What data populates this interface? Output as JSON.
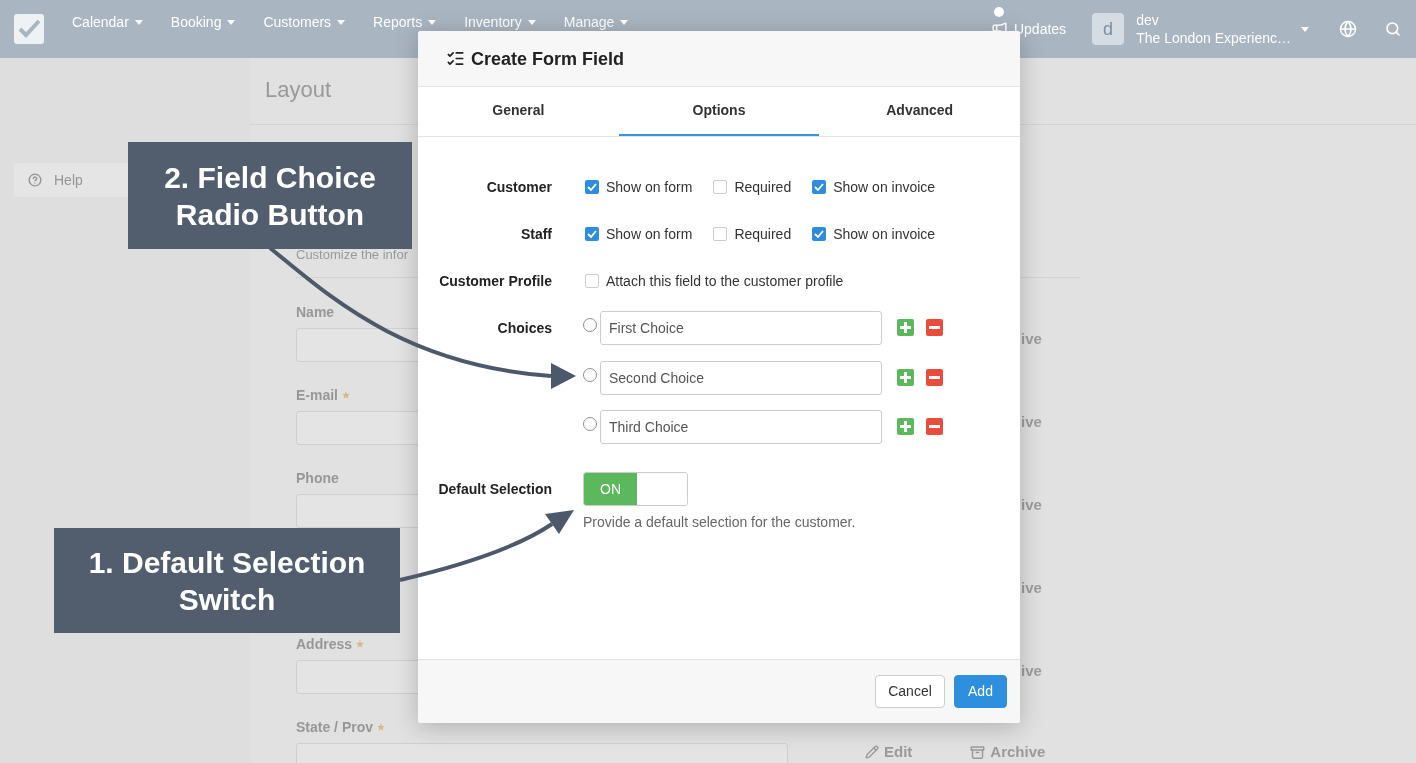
{
  "nav": {
    "items": [
      {
        "label": "Calendar"
      },
      {
        "label": "Booking"
      },
      {
        "label": "Customers"
      },
      {
        "label": "Reports"
      },
      {
        "label": "Inventory"
      },
      {
        "label": "Manage"
      }
    ],
    "updates": "Updates",
    "user": {
      "initial": "d",
      "name": "dev",
      "organization": "The London Experienc…"
    }
  },
  "sidebar": {
    "items": [
      {
        "label": "Help"
      }
    ]
  },
  "page": {
    "title": "Layout",
    "description": "Customize the infor",
    "fields": [
      {
        "label": "Name",
        "required": false,
        "archive": "ive"
      },
      {
        "label": "E-mail",
        "required": true,
        "archive": "ive"
      },
      {
        "label": "Phone",
        "required": false,
        "archive": "ive"
      },
      {
        "archive": "ive"
      },
      {
        "label": "Address",
        "required": true,
        "archive": "ive"
      },
      {
        "label": "State / Prov",
        "required": true,
        "edit": "Edit",
        "archive": "Archive"
      }
    ]
  },
  "modal": {
    "title": "Create Form Field",
    "tabs": [
      {
        "label": "General",
        "selected": false
      },
      {
        "label": "Options",
        "selected": true
      },
      {
        "label": "Advanced",
        "selected": false
      }
    ],
    "rows": [
      {
        "kind": "checkboxes",
        "label": "Customer",
        "options": [
          {
            "label": "Show on form",
            "checked": true
          },
          {
            "label": "Required",
            "checked": false
          },
          {
            "label": "Show on invoice",
            "checked": true
          }
        ]
      },
      {
        "kind": "checkboxes",
        "label": "Staff",
        "options": [
          {
            "label": "Show on form",
            "checked": true
          },
          {
            "label": "Required",
            "checked": false
          },
          {
            "label": "Show on invoice",
            "checked": true
          }
        ]
      },
      {
        "kind": "checkboxes",
        "label": "Customer Profile",
        "options": [
          {
            "label": "Attach this field to the customer profile",
            "checked": false
          }
        ]
      },
      {
        "kind": "choices",
        "label": "Choices",
        "choices": [
          {
            "value": "First Choice",
            "selected": false
          },
          {
            "value": "Second Choice",
            "selected": false
          },
          {
            "value": "Third Choice",
            "selected": false
          }
        ]
      },
      {
        "kind": "switch",
        "label": "Default Selection",
        "switch": {
          "label": "ON",
          "on": true
        },
        "help": "Provide a default selection for the customer."
      }
    ],
    "buttons": [
      {
        "label": "Cancel",
        "kind": "secondary"
      },
      {
        "label": "Add",
        "kind": "primary"
      }
    ]
  },
  "callouts": [
    {
      "text": "2. Field Choice Radio Button"
    },
    {
      "text": "1. Default Selection Switch"
    }
  ]
}
